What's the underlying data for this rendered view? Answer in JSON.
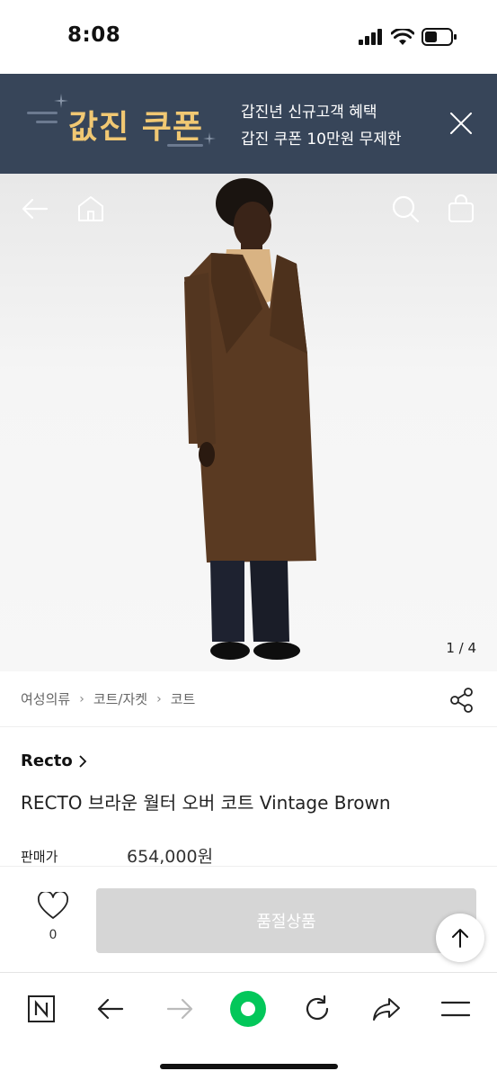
{
  "status_bar": {
    "time": "8:08"
  },
  "coupon_banner": {
    "logo_text": "값진 쿠폰",
    "line1": "갑진년 신규고객 혜택",
    "line2": "갑진 쿠폰 10만원 무제한"
  },
  "product_image": {
    "counter": "1 / 4"
  },
  "breadcrumb": {
    "items": [
      "여성의류",
      "코트/자켓",
      "코트"
    ]
  },
  "product": {
    "brand": "Recto",
    "title": "RECTO 브라운 월터 오버 코트 Vintage Brown",
    "price_label": "판매가",
    "price": "654,000원"
  },
  "purchase_bar": {
    "like_count": "0",
    "soldout_label": "품절상품"
  },
  "colors": {
    "banner_bg": "#374559",
    "coupon_gold": "#f1c873",
    "naver_green": "#03c75a",
    "soldout_bg": "#d6d6d6"
  }
}
